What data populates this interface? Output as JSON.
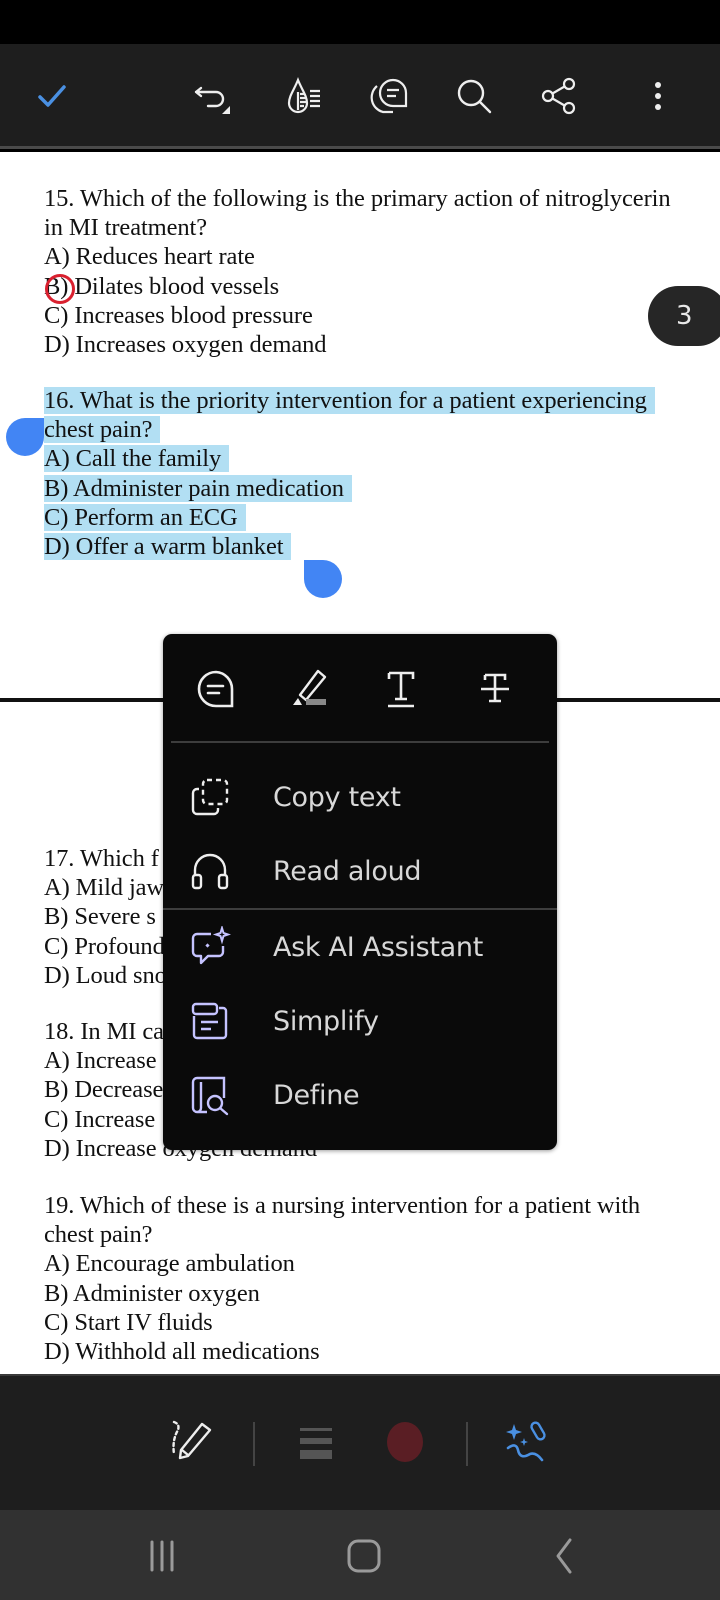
{
  "toolbar": {
    "done": "check-icon",
    "undo": "undo-icon",
    "liquid_mode": "liquid-mode-icon",
    "comments": "comments-icon",
    "search": "search-icon",
    "share": "share-icon",
    "more": "more-vertical-icon",
    "accent_color": "#4a90e2"
  },
  "page_indicator": "3",
  "document": {
    "q15": {
      "lines": [
        "15. Which of the following is the primary action of nitroglycerin",
        "in MI treatment?",
        "A) Reduces heart rate",
        "B) Dilates blood vessels",
        "C) Increases blood pressure",
        "D) Increases oxygen demand"
      ],
      "annotation": "B circled in red",
      "annotation_color": "#d9202f"
    },
    "q16": {
      "lines": [
        "16. What is the priority intervention for a patient experiencing",
        "chest pain?",
        "A) Call the family",
        "B) Administer pain medication",
        "C) Perform an ECG",
        "D) Offer a warm blanket"
      ],
      "selected": true,
      "selection_color": "#b2dff3"
    },
    "q17": {
      "lines": [
        "17. Which f",
        "A) Mild jaw",
        "B) Severe s",
        "C) Profound",
        "D) Loud sno"
      ]
    },
    "q18": {
      "lines": [
        "18. In MI ca",
        "A) Increase",
        "B) Decrease",
        "C) Increase",
        "D) Increase oxygen demand"
      ]
    },
    "q19": {
      "lines": [
        "19. Which of these is a nursing intervention for a patient with",
        "chest pain?",
        "A) Encourage ambulation",
        "B) Administer oxygen",
        "C) Start IV fluids",
        "D) Withhold all medications"
      ]
    }
  },
  "context_menu": {
    "quick_actions": [
      {
        "name": "add-comment",
        "icon": "comment-icon"
      },
      {
        "name": "highlight",
        "icon": "highlighter-icon"
      },
      {
        "name": "underline",
        "icon": "underline-icon"
      },
      {
        "name": "strikethrough",
        "icon": "strikethrough-icon"
      }
    ],
    "items": [
      {
        "label": "Copy text",
        "icon": "copy-icon"
      },
      {
        "label": "Read aloud",
        "icon": "headphones-icon"
      },
      {
        "label": "Ask AI Assistant",
        "icon": "ai-assistant-icon"
      },
      {
        "label": "Simplify",
        "icon": "simplify-icon"
      },
      {
        "label": "Define",
        "icon": "define-icon"
      }
    ],
    "ai_icon_color": "#c5c3ff"
  },
  "bottom_toolbar": {
    "draw": "draw-icon",
    "thickness": "line-thickness-icon",
    "color": "#5a1e24",
    "ai_tool": "ai-draw-icon",
    "ai_color": "#4a90e2"
  },
  "nav": {
    "recents": "recents-icon",
    "home": "home-icon",
    "back": "back-icon"
  }
}
